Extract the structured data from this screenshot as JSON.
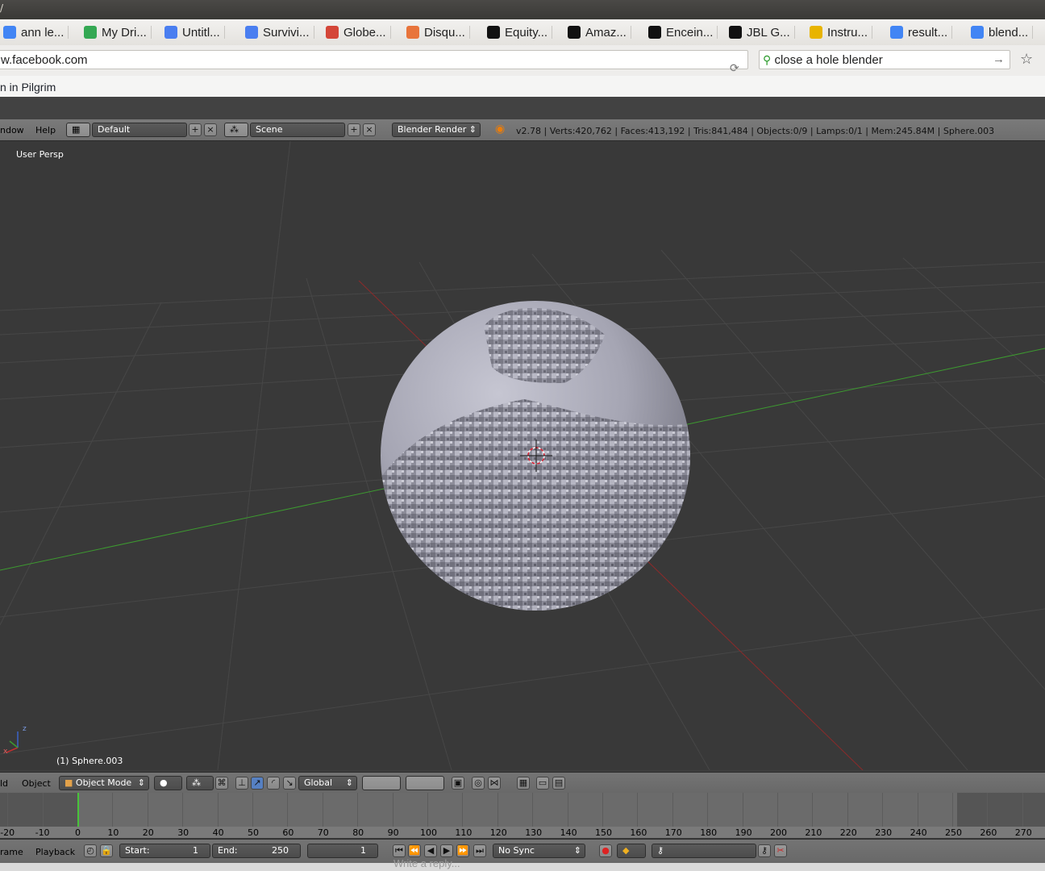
{
  "titlebar": {
    "glyph": "/"
  },
  "bookmarks": [
    {
      "label": "ann le...",
      "icon": "google-icon",
      "color": "#4285f4"
    },
    {
      "label": "My Dri...",
      "icon": "drive-icon",
      "color": "#34a853"
    },
    {
      "label": "Untitl...",
      "icon": "docs-icon",
      "color": "#4a7ef0"
    },
    {
      "label": "Survivi...",
      "icon": "docs-icon",
      "color": "#4a7ef0"
    },
    {
      "label": "Globe...",
      "icon": "gmail-icon",
      "color": "#d44638"
    },
    {
      "label": "Disqu...",
      "icon": "cube-icon",
      "color": "#e8743b"
    },
    {
      "label": "Equity...",
      "icon": "lse-icon",
      "color": "#111111"
    },
    {
      "label": "Amaz...",
      "icon": "amazon-icon",
      "color": "#111111"
    },
    {
      "label": "Encein...",
      "icon": "amazon-icon",
      "color": "#111111"
    },
    {
      "label": "JBL G...",
      "icon": "amazon-icon",
      "color": "#111111"
    },
    {
      "label": "Instru...",
      "icon": "instructables-icon",
      "color": "#e8b400"
    },
    {
      "label": "result...",
      "icon": "google-icon",
      "color": "#4285f4"
    },
    {
      "label": "blend...",
      "icon": "google-icon",
      "color": "#4285f4"
    }
  ],
  "address": {
    "url": "w.facebook.com",
    "search": "close a hole blender"
  },
  "facebook": {
    "crumb": "n in Pilgrim"
  },
  "blender": {
    "menu": {
      "window": "ndow",
      "help": "Help"
    },
    "layout": "Default",
    "scene": "Scene",
    "engine": "Blender Render",
    "stats": "v2.78 | Verts:420,762 | Faces:413,192 | Tris:841,484 | Objects:0/9 | Lamps:0/1 | Mem:245.84M | Sphere.003",
    "viewport": {
      "persp": "User Persp",
      "object_label": "(1) Sphere.003",
      "axis_x": "x",
      "axis_z": "z"
    },
    "view3d_header": {
      "menu_add": "ld",
      "menu_object": "Object",
      "mode": "Object Mode",
      "orientation": "Global"
    },
    "timeline": {
      "ticks": [
        "-20",
        "-10",
        "0",
        "10",
        "20",
        "30",
        "40",
        "50",
        "60",
        "70",
        "80",
        "90",
        "100",
        "110",
        "120",
        "130",
        "140",
        "150",
        "160",
        "170",
        "180",
        "190",
        "200",
        "210",
        "220",
        "230",
        "240",
        "250",
        "260",
        "270"
      ],
      "menu_frame": "rame",
      "menu_playback": "Playback",
      "start_label": "Start:",
      "start_value": "1",
      "end_label": "End:",
      "end_value": "250",
      "current_frame": "1",
      "sync": "No Sync"
    },
    "underlay_text": "Write a reply..."
  },
  "colors": {
    "x_axis": "#9b2c2c",
    "y_axis": "#3b9a2f",
    "grid": "#4a4a4a",
    "sphere": "#a9a9b8",
    "timeline_cursor": "#48c33a"
  }
}
